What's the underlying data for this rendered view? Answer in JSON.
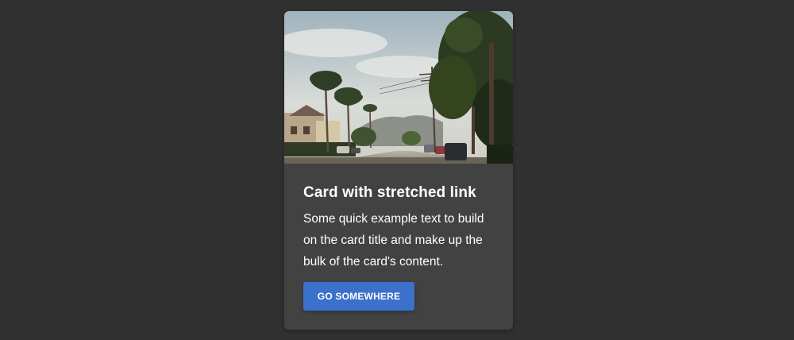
{
  "card": {
    "image_alt": "Palm tree lined street with Hollywood hills in the background",
    "title": "Card with stretched link",
    "text": "Some quick example text to build on the card title and make up the bulk of the card's content.",
    "button_label": "GO SOMEWHERE"
  },
  "colors": {
    "page_background": "#303030",
    "card_background": "#424242",
    "button": "#3b71ca",
    "text": "#ffffff"
  }
}
